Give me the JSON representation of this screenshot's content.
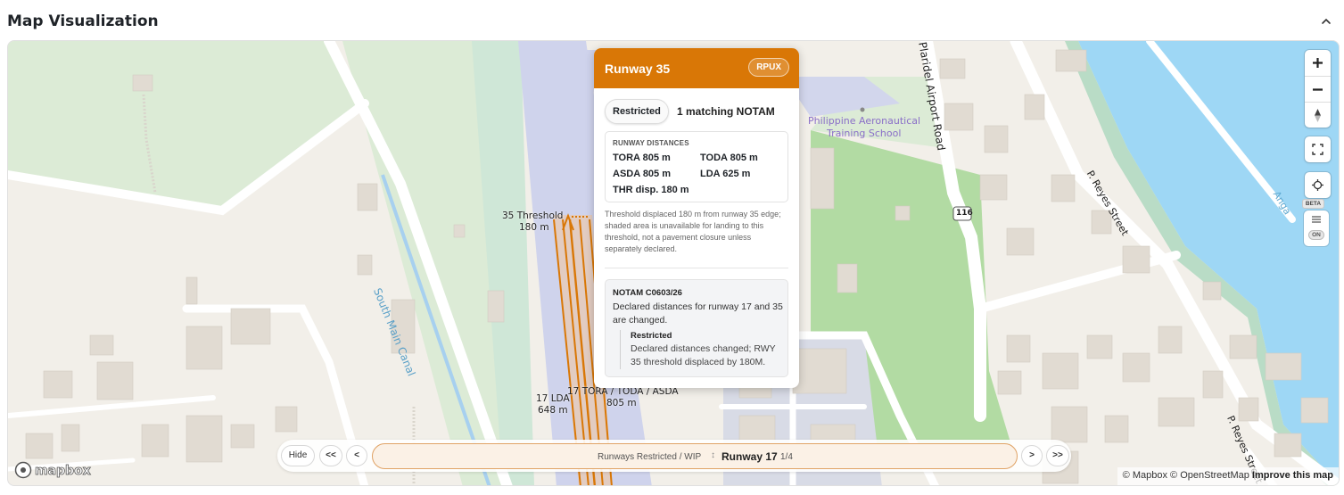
{
  "section": {
    "title": "Map Visualization"
  },
  "colors": {
    "accent": "#d97706",
    "runway": "#cfd3ec",
    "water": "#9ed7f5",
    "park": "#add19e"
  },
  "icons": {
    "collapse": "chevron-up-icon",
    "zoom_in": "plus-icon",
    "zoom_out": "minus-icon",
    "compass": "compass-icon",
    "fullscreen": "fullscreen-icon",
    "locate": "crosshair-icon",
    "layers": "layers-icon"
  },
  "map": {
    "labels": {
      "canal": "South Main Canal",
      "school_line1": "Philippine Aeronautical",
      "school_line2": "Training School",
      "road1": "Plaridel Airport Road",
      "road2": "P. Reyes Street",
      "road3": "P. Reyes Street",
      "shield": "116",
      "water_partial": "Anga"
    },
    "runway_labels": {
      "thr35_title": "35 Threshold",
      "thr35_value": "180 m",
      "lda17_title": "17 LDA",
      "lda17_value": "648 m",
      "tora17_title": "17 TORA / TODA / ASDA",
      "tora17_value": "805 m"
    }
  },
  "popup": {
    "title": "Runway 35",
    "airport_code": "RPUX",
    "status": "Restricted",
    "match_text": "1 matching NOTAM",
    "distances_heading": "RUNWAY DISTANCES",
    "tora": "TORA 805 m",
    "toda": "TODA 805 m",
    "asda": "ASDA 805 m",
    "lda": "LDA 625 m",
    "thr": "THR disp. 180 m",
    "note": "Threshold displaced 180 m from runway 35 edge; shaded area is unavailable for landing to this threshold, not a pavement closure unless separately declared.",
    "notam": {
      "id": "NOTAM C0603/26",
      "description": "Declared distances for runway 17 and 35 are changed.",
      "restriction_title": "Restricted",
      "restriction_text": "Declared distances changed; RWY 35 threshold displaced by 180M."
    }
  },
  "controls": {
    "beta": "BETA",
    "toggle": "ON"
  },
  "nav": {
    "hide": "Hide",
    "first": "<<",
    "prev": "<",
    "next": ">",
    "last": ">>",
    "group": "Runways Restricted / WIP",
    "separator": "↕",
    "current": "Runway 17",
    "count": "1/4"
  },
  "attribution": {
    "mapbox": "© Mapbox",
    "osm": "© OpenStreetMap",
    "improve": "Improve this map"
  },
  "logo": {
    "text": "mapbox"
  }
}
